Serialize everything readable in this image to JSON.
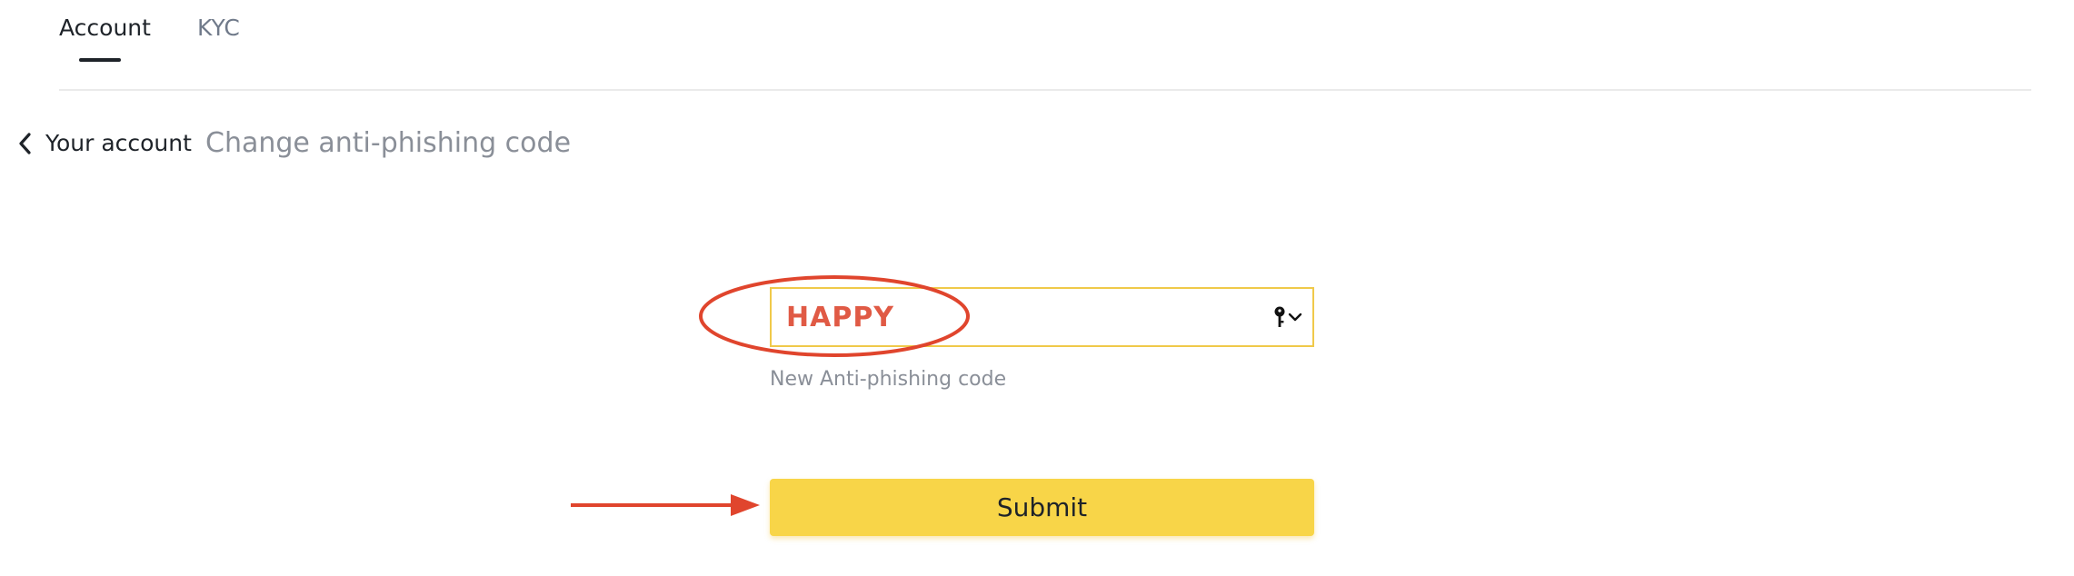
{
  "tabs": [
    {
      "label": "Account",
      "active": true
    },
    {
      "label": "KYC",
      "active": false
    }
  ],
  "breadcrumb": {
    "back_label": "Your account",
    "title": "Change anti-phishing code"
  },
  "form": {
    "code_value": "HAPPY",
    "code_help": "New Anti-phishing code",
    "suffix_icons": [
      "key-icon",
      "chevron-down-icon"
    ],
    "submit_label": "Submit"
  },
  "colors": {
    "accent_yellow": "#f8d548",
    "field_border": "#f0c94a",
    "annotation_red": "#e0452d",
    "code_text": "#e05a45"
  }
}
